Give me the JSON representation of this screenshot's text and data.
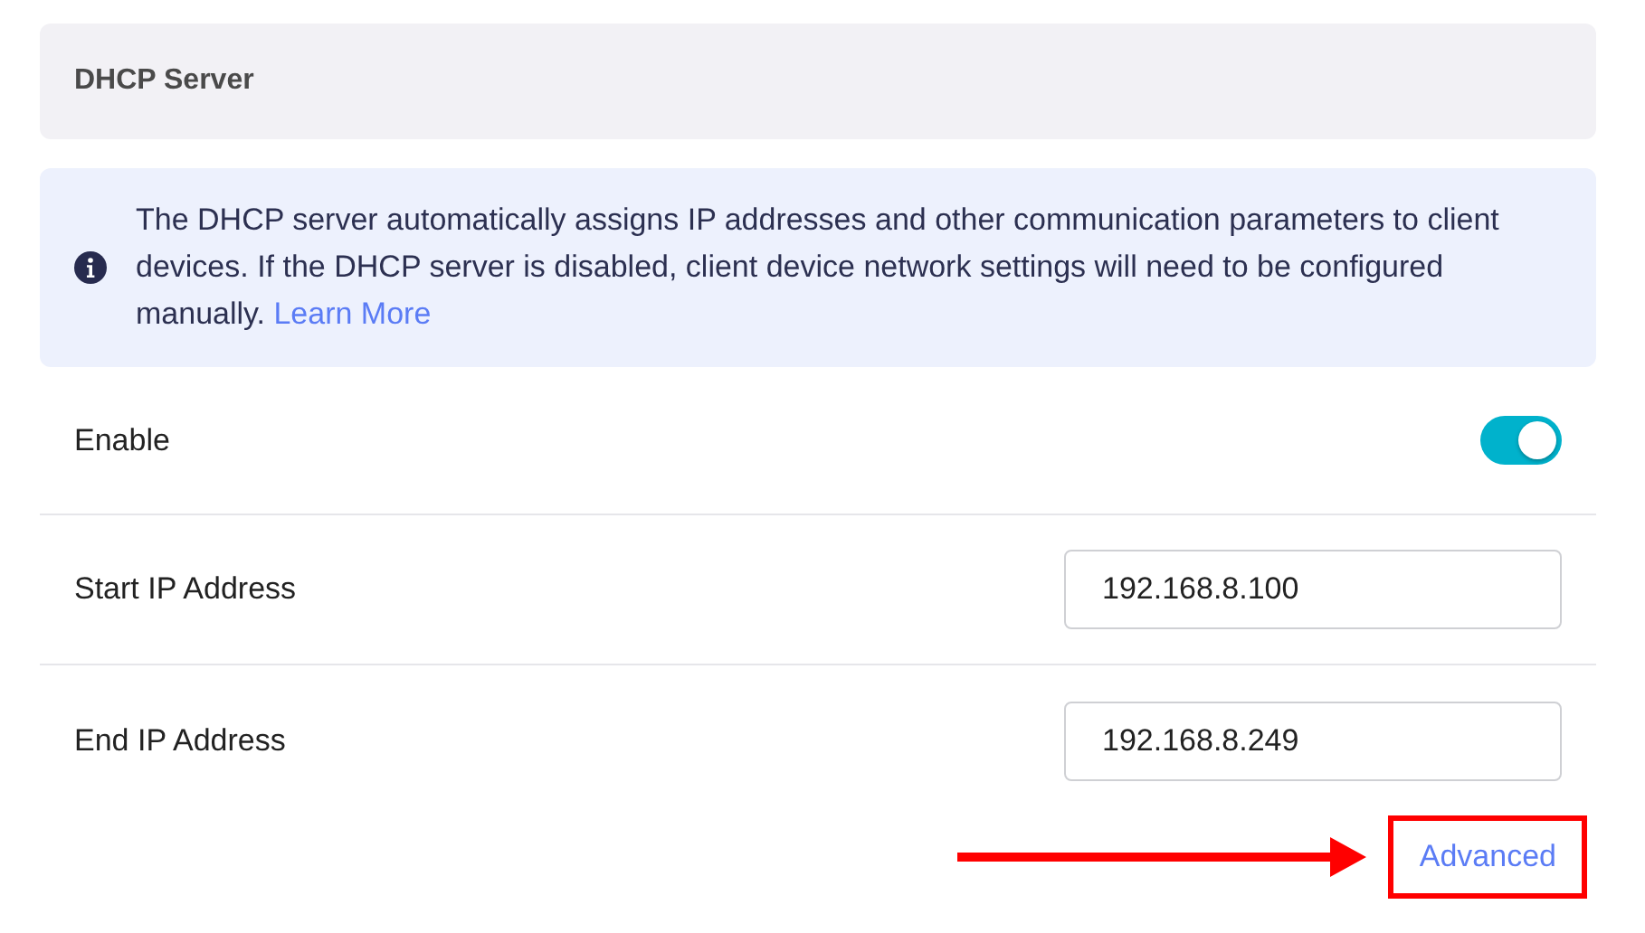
{
  "section_title": "DHCP Server",
  "info": {
    "text": "The DHCP server automatically assigns IP addresses and other communication parameters to client devices. If the DHCP server is disabled, client device network settings will need to be configured manually.",
    "link": "Learn More"
  },
  "rows": [
    {
      "kind": "toggle",
      "label": "Enable",
      "on": true
    },
    {
      "kind": "input",
      "label": "Start IP Address",
      "value": "192.168.8.100"
    },
    {
      "kind": "input",
      "label": "End IP Address",
      "value": "192.168.8.249"
    }
  ],
  "advanced_link": {
    "label": "Advanced",
    "highlighted": true,
    "pointer_arrow": true
  }
}
